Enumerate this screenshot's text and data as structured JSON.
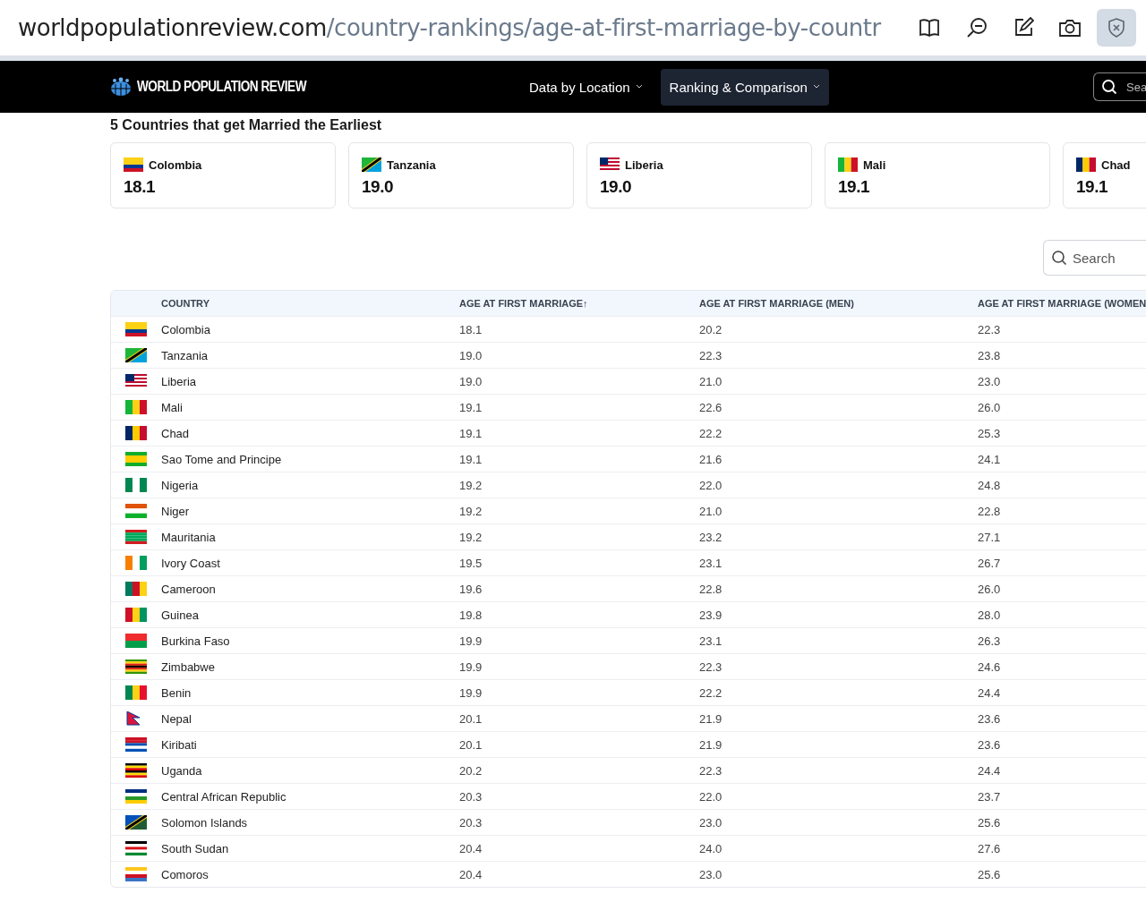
{
  "browser": {
    "url_domain": "worldpopulationreview.com",
    "url_path": "/country-rankings/age-at-first-marriage-by-countr"
  },
  "nav": {
    "logo": "WORLD POPULATION REVIEW",
    "items": [
      {
        "label": "Data by Location",
        "selected": false
      },
      {
        "label": "Ranking & Comparison",
        "selected": true
      }
    ],
    "search_placeholder": "Sea"
  },
  "highlights": {
    "title": "5 Countries that get Married the Earliest",
    "cards": [
      {
        "country": "Colombia",
        "value": "18.1"
      },
      {
        "country": "Tanzania",
        "value": "19.0"
      },
      {
        "country": "Liberia",
        "value": "19.0"
      },
      {
        "country": "Mali",
        "value": "19.1"
      },
      {
        "country": "Chad",
        "value": "19.1"
      }
    ]
  },
  "search": {
    "placeholder": "Search"
  },
  "table": {
    "columns": [
      {
        "label": "COUNTRY"
      },
      {
        "label": "AGE AT FIRST MARRIAGE",
        "sort": "↑"
      },
      {
        "label": "AGE AT FIRST MARRIAGE (MEN)"
      },
      {
        "label": "AGE AT FIRST MARRIAGE (WOMEN"
      }
    ],
    "rows": [
      [
        "Colombia",
        "18.1",
        "20.2",
        "22.3"
      ],
      [
        "Tanzania",
        "19.0",
        "22.3",
        "23.8"
      ],
      [
        "Liberia",
        "19.0",
        "21.0",
        "23.0"
      ],
      [
        "Mali",
        "19.1",
        "22.6",
        "26.0"
      ],
      [
        "Chad",
        "19.1",
        "22.2",
        "25.3"
      ],
      [
        "Sao Tome and Principe",
        "19.1",
        "21.6",
        "24.1"
      ],
      [
        "Nigeria",
        "19.2",
        "22.0",
        "24.8"
      ],
      [
        "Niger",
        "19.2",
        "21.0",
        "22.8"
      ],
      [
        "Mauritania",
        "19.2",
        "23.2",
        "27.1"
      ],
      [
        "Ivory Coast",
        "19.5",
        "23.1",
        "26.7"
      ],
      [
        "Cameroon",
        "19.6",
        "22.8",
        "26.0"
      ],
      [
        "Guinea",
        "19.8",
        "23.9",
        "28.0"
      ],
      [
        "Burkina Faso",
        "19.9",
        "23.1",
        "26.3"
      ],
      [
        "Zimbabwe",
        "19.9",
        "22.3",
        "24.6"
      ],
      [
        "Benin",
        "19.9",
        "22.2",
        "24.4"
      ],
      [
        "Nepal",
        "20.1",
        "21.9",
        "23.6"
      ],
      [
        "Kiribati",
        "20.1",
        "21.9",
        "23.6"
      ],
      [
        "Uganda",
        "20.2",
        "22.3",
        "24.4"
      ],
      [
        "Central African Republic",
        "20.3",
        "22.0",
        "23.7"
      ],
      [
        "Solomon Islands",
        "20.3",
        "23.0",
        "25.6"
      ],
      [
        "South Sudan",
        "20.4",
        "24.0",
        "27.6"
      ],
      [
        "Comoros",
        "20.4",
        "23.0",
        "25.6"
      ]
    ]
  }
}
